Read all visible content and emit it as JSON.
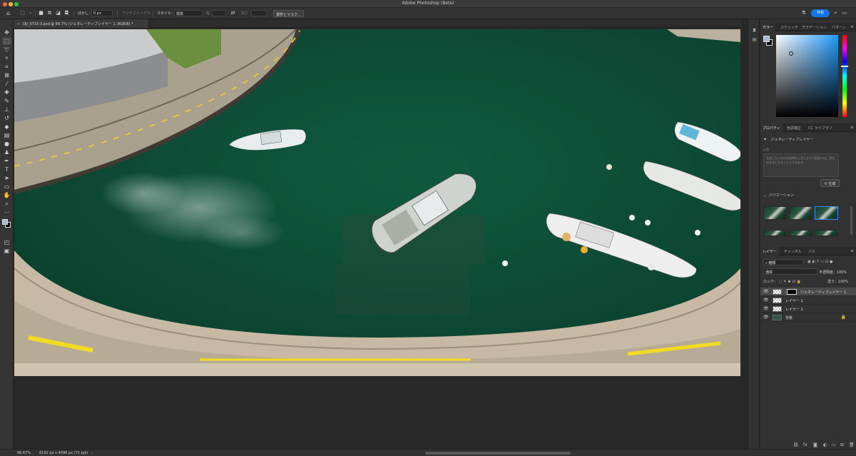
{
  "app": {
    "title": "Adobe Photoshop (Beta)",
    "share_label": "共有"
  },
  "options": {
    "feather_label": "ぼかし：",
    "feather_value": "0 px",
    "antialias_label": "アンチエイリアス",
    "style_label": "スタイル：",
    "style_value": "標準",
    "width_label": "幅",
    "height_label": "高さ",
    "select_mask_label": "選択とマスク..."
  },
  "document": {
    "tab_label": "DJI_0715-3.psd @ 66.7% (ジェネレーティブレイヤー 1, RGB/8) *",
    "close_glyph": "×"
  },
  "status": {
    "zoom": "66.67%",
    "doc_size": "8192 px x 4096 px (72 ppi)",
    "arrow": "›"
  },
  "color_panel": {
    "tabs": [
      "カラー",
      "スウォッチ",
      "グラデーション",
      "パターン"
    ],
    "foreground": "#a7bad0",
    "background": "#000000"
  },
  "properties_panel": {
    "tabs": [
      "プロパティ",
      "色調補正",
      "CC ライブラリ"
    ],
    "layer_type": "ジェネレーティブレイヤー",
    "prompt_label": "入力",
    "prompt_placeholder": "生成したいものの説明を入力します [英語のみ]。空白のままにすることもできます。",
    "generate_label": "生成",
    "variations_label": "バリエーション"
  },
  "layers_panel": {
    "tabs": [
      "レイヤー",
      "チャンネル",
      "パス"
    ],
    "search_value": "種類",
    "blend_mode": "通常",
    "opacity_label": "不透明度：",
    "opacity_value": "100%",
    "lock_label": "ロック：",
    "fill_label": "塗り：",
    "fill_value": "100%",
    "layers": [
      {
        "name": "ジェネレーティブレイヤー 1"
      },
      {
        "name": "レイヤー 1"
      },
      {
        "name": "レイヤー 2"
      },
      {
        "name": "背景"
      }
    ]
  }
}
